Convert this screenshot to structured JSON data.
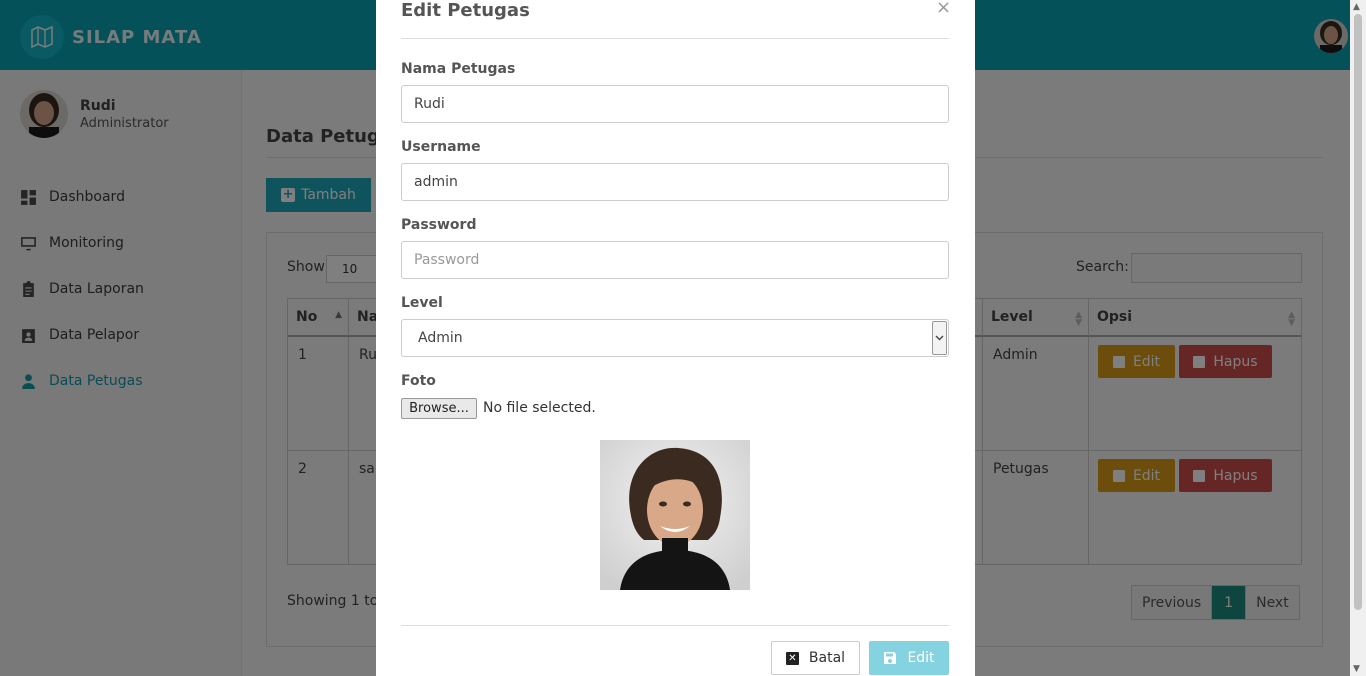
{
  "app": {
    "brand": "SILAP MATA"
  },
  "user": {
    "name": "Rudi",
    "role": "Administrator"
  },
  "sidebar": {
    "items": [
      {
        "label": "Dashboard",
        "icon": "dashboard-icon"
      },
      {
        "label": "Monitoring",
        "icon": "monitor-icon"
      },
      {
        "label": "Data Laporan",
        "icon": "clipboard-icon"
      },
      {
        "label": "Data Pelapor",
        "icon": "id-card-icon"
      },
      {
        "label": "Data Petugas",
        "icon": "user-icon",
        "active": true
      }
    ]
  },
  "main": {
    "title": "Data Petugas",
    "add_button": "Tambah",
    "show_label": "Show",
    "show_value": "10",
    "search_label": "Search:",
    "table": {
      "headers": {
        "no": "No",
        "nama": "Na",
        "level": "Level",
        "opsi": "Opsi"
      },
      "rows": [
        {
          "no": "1",
          "nama": "Ru",
          "level": "Admin"
        },
        {
          "no": "2",
          "nama": "sar",
          "level": "Petugas"
        }
      ],
      "edit_label": "Edit",
      "delete_label": "Hapus"
    },
    "showing_text": "Showing 1 to",
    "pagination": {
      "prev": "Previous",
      "current": "1",
      "next": "Next"
    }
  },
  "modal": {
    "title": "Edit Petugas",
    "close": "×",
    "nama_label": "Nama Petugas",
    "nama_value": "Rudi",
    "username_label": "Username",
    "username_value": "admin",
    "password_label": "Password",
    "password_placeholder": "Password",
    "level_label": "Level",
    "level_value": "Admin",
    "foto_label": "Foto",
    "browse_label": "Browse...",
    "file_status": "No file selected.",
    "cancel_label": "Batal",
    "submit_label": "Edit"
  },
  "colors": {
    "header": "#0aa3b5",
    "active_nav": "#1298a8",
    "edit_button": "#d99a16",
    "delete_button": "#cc4d4d",
    "pagination_active": "#1c8b7e",
    "submit_button": "#85d2e1"
  }
}
